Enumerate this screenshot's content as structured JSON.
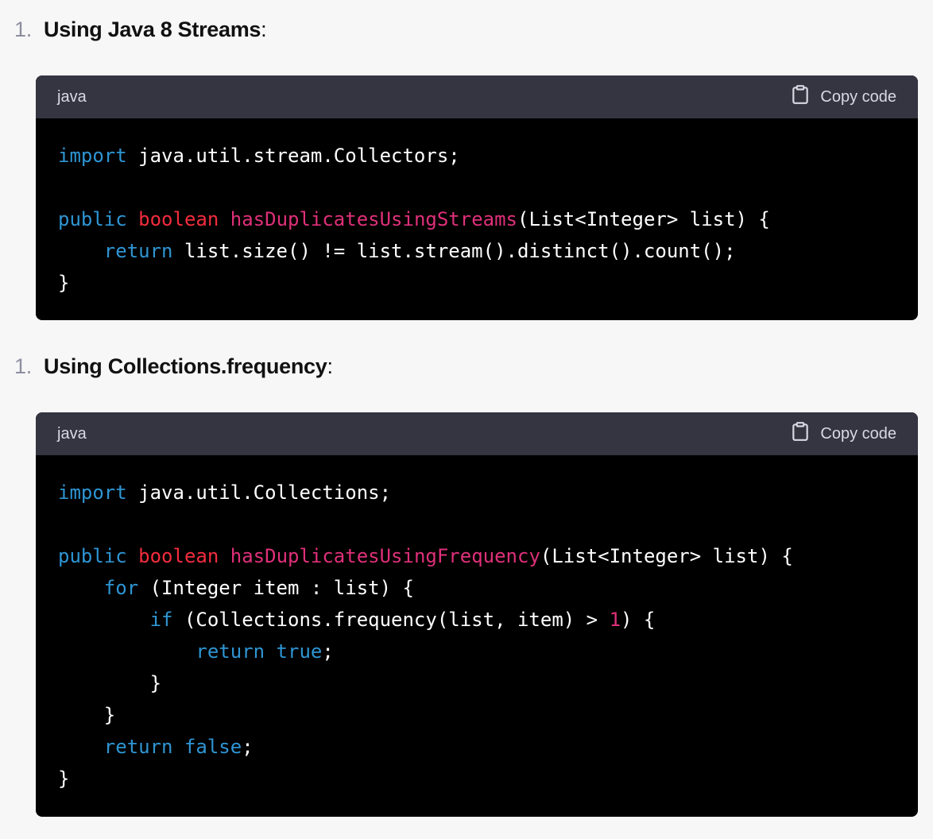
{
  "items": [
    {
      "number": "1.",
      "title": "Using Java 8 Streams",
      "suffix": ":"
    },
    {
      "number": "1.",
      "title": "Using Collections.frequency",
      "suffix": ":"
    }
  ],
  "code_blocks": [
    {
      "language": "java",
      "copy_label": "Copy code",
      "lines": [
        [
          {
            "t": "import",
            "c": "kw"
          },
          {
            "t": " java.util.stream.Collectors;",
            "c": ""
          }
        ],
        [],
        [
          {
            "t": "public",
            "c": "kw"
          },
          {
            "t": " ",
            "c": ""
          },
          {
            "t": "boolean",
            "c": "ty"
          },
          {
            "t": " ",
            "c": ""
          },
          {
            "t": "hasDuplicatesUsingStreams",
            "c": "fn"
          },
          {
            "t": "(List<Integer> list) {",
            "c": ""
          }
        ],
        [
          {
            "t": "    ",
            "c": ""
          },
          {
            "t": "return",
            "c": "kw"
          },
          {
            "t": " list.size() != list.stream().distinct().count();",
            "c": ""
          }
        ],
        [
          {
            "t": "}",
            "c": ""
          }
        ]
      ]
    },
    {
      "language": "java",
      "copy_label": "Copy code",
      "lines": [
        [
          {
            "t": "import",
            "c": "kw"
          },
          {
            "t": " java.util.Collections;",
            "c": ""
          }
        ],
        [],
        [
          {
            "t": "public",
            "c": "kw"
          },
          {
            "t": " ",
            "c": ""
          },
          {
            "t": "boolean",
            "c": "ty"
          },
          {
            "t": " ",
            "c": ""
          },
          {
            "t": "hasDuplicatesUsingFrequency",
            "c": "fn"
          },
          {
            "t": "(List<Integer> list) {",
            "c": ""
          }
        ],
        [
          {
            "t": "    ",
            "c": ""
          },
          {
            "t": "for",
            "c": "kw"
          },
          {
            "t": " (Integer item : list) {",
            "c": ""
          }
        ],
        [
          {
            "t": "        ",
            "c": ""
          },
          {
            "t": "if",
            "c": "kw"
          },
          {
            "t": " (Collections.frequency(list, item) > ",
            "c": ""
          },
          {
            "t": "1",
            "c": "nm"
          },
          {
            "t": ") {",
            "c": ""
          }
        ],
        [
          {
            "t": "            ",
            "c": ""
          },
          {
            "t": "return",
            "c": "kw"
          },
          {
            "t": " ",
            "c": ""
          },
          {
            "t": "true",
            "c": "kw"
          },
          {
            "t": ";",
            "c": ""
          }
        ],
        [
          {
            "t": "        }",
            "c": ""
          }
        ],
        [
          {
            "t": "    }",
            "c": ""
          }
        ],
        [
          {
            "t": "    ",
            "c": ""
          },
          {
            "t": "return",
            "c": "kw"
          },
          {
            "t": " ",
            "c": ""
          },
          {
            "t": "false",
            "c": "kw"
          },
          {
            "t": ";",
            "c": ""
          }
        ],
        [
          {
            "t": "}",
            "c": ""
          }
        ]
      ]
    }
  ],
  "icons": {
    "copy": "clipboard-icon"
  },
  "colors": {
    "keyword": "#2e95d3",
    "type": "#f22c3d",
    "function": "#df3079",
    "number": "#df3079",
    "header_bg": "#343541",
    "code_bg": "#000000",
    "page_bg": "#f7f7f8"
  }
}
